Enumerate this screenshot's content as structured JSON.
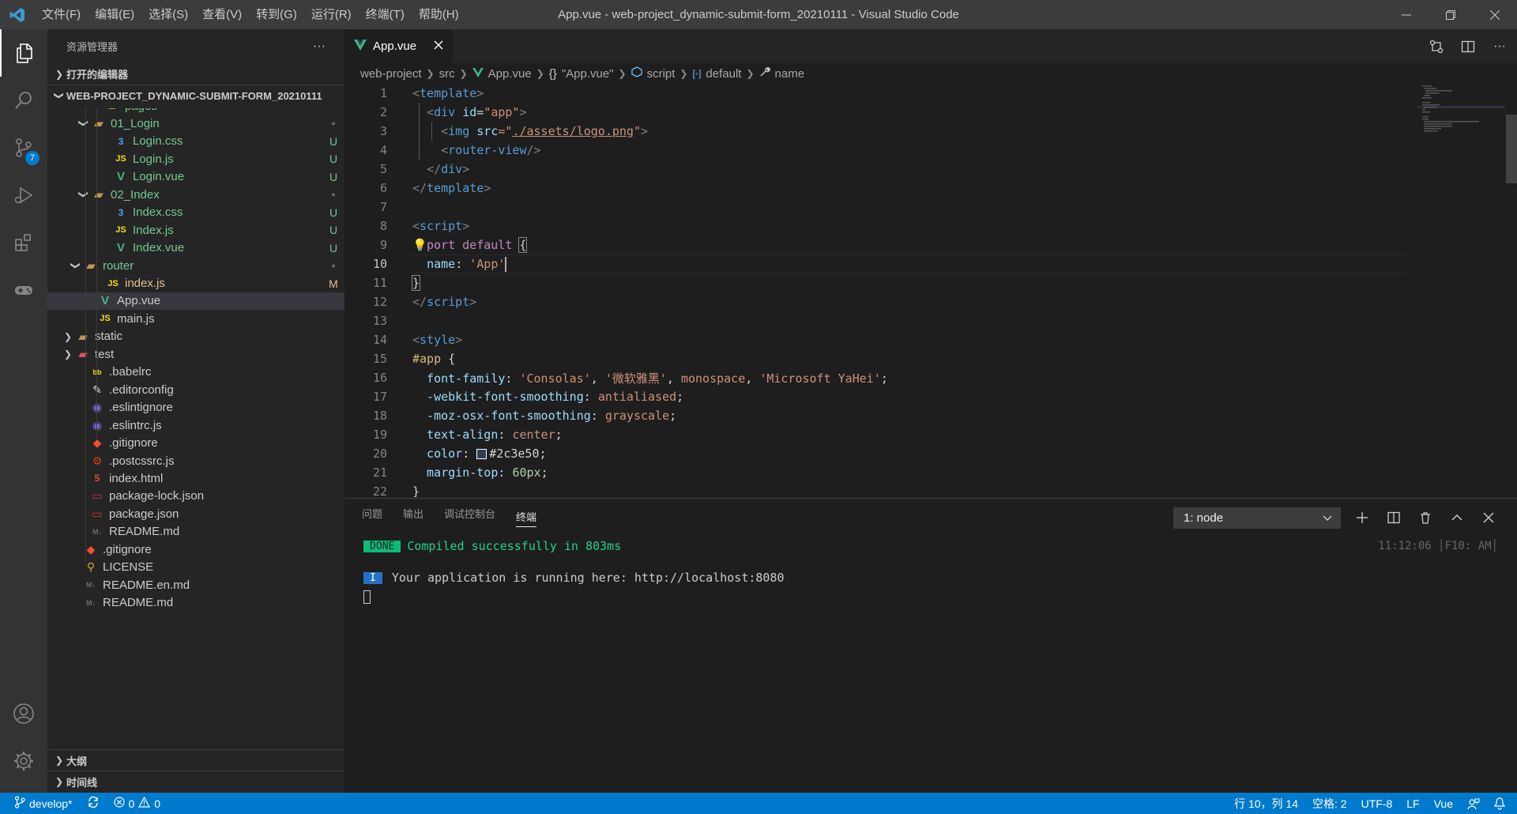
{
  "titlebar": {
    "menus": [
      "文件(F)",
      "编辑(E)",
      "选择(S)",
      "查看(V)",
      "转到(G)",
      "运行(R)",
      "终端(T)",
      "帮助(H)"
    ],
    "title": "App.vue - web-project_dynamic-submit-form_20210111 - Visual Studio Code"
  },
  "activitybar": {
    "scm_badge": "7"
  },
  "sidebar": {
    "title": "资源管理器",
    "more": "···",
    "open_editors": "打开的编辑器",
    "project": "WEB-PROJECT_DYNAMIC-SUBMIT-FORM_20210111",
    "outline": "大纲",
    "timeline": "时间线",
    "tree": [
      {
        "label": "pages",
        "icon": "folder-icon",
        "status": ""
      },
      {
        "label": "01_Login",
        "icon": "folder-icon",
        "status": "●"
      },
      {
        "label": "Login.css",
        "icon": "css-icon",
        "status": "U"
      },
      {
        "label": "Login.js",
        "icon": "js-icon",
        "status": "U"
      },
      {
        "label": "Login.vue",
        "icon": "vue-icon",
        "status": "U"
      },
      {
        "label": "02_Index",
        "icon": "folder-icon",
        "status": "●"
      },
      {
        "label": "Index.css",
        "icon": "css-icon",
        "status": "U"
      },
      {
        "label": "Index.js",
        "icon": "js-icon",
        "status": "U"
      },
      {
        "label": "Index.vue",
        "icon": "vue-icon",
        "status": "U"
      },
      {
        "label": "router",
        "icon": "folder-icon",
        "status": "●"
      },
      {
        "label": "index.js",
        "icon": "js-icon",
        "status": "M"
      },
      {
        "label": "App.vue",
        "icon": "vue-icon",
        "status": ""
      },
      {
        "label": "main.js",
        "icon": "js-icon",
        "status": ""
      },
      {
        "label": "static",
        "icon": "folder-icon",
        "status": ""
      },
      {
        "label": "test",
        "icon": "test-folder-icon",
        "status": ""
      },
      {
        "label": ".babelrc",
        "icon": "babel-icon",
        "status": ""
      },
      {
        "label": ".editorconfig",
        "icon": "editorconfig-icon",
        "status": ""
      },
      {
        "label": ".eslintignore",
        "icon": "eslint-icon",
        "status": ""
      },
      {
        "label": ".eslintrc.js",
        "icon": "eslint-icon",
        "status": ""
      },
      {
        "label": ".gitignore",
        "icon": "git-icon",
        "status": ""
      },
      {
        "label": ".postcssrc.js",
        "icon": "postcss-icon",
        "status": ""
      },
      {
        "label": "index.html",
        "icon": "html-icon",
        "status": ""
      },
      {
        "label": "package-lock.json",
        "icon": "npm-icon",
        "status": ""
      },
      {
        "label": "package.json",
        "icon": "npm-icon",
        "status": ""
      },
      {
        "label": "README.md",
        "icon": "markdown-icon",
        "status": ""
      },
      {
        "label": ".gitignore",
        "icon": "git-icon",
        "status": ""
      },
      {
        "label": "LICENSE",
        "icon": "license-icon",
        "status": ""
      },
      {
        "label": "README.en.md",
        "icon": "markdown-icon",
        "status": ""
      },
      {
        "label": "README.md",
        "icon": "markdown-icon",
        "status": ""
      }
    ]
  },
  "editor": {
    "tab_label": "App.vue",
    "breadcrumb": [
      "web-project",
      "src",
      "App.vue",
      "\"App.vue\"",
      "script",
      "default",
      "name"
    ],
    "line_numbers": [
      "1",
      "2",
      "3",
      "4",
      "5",
      "6",
      "7",
      "8",
      "9",
      "10",
      "11",
      "12",
      "13",
      "14",
      "15",
      "16",
      "17",
      "18",
      "19",
      "20",
      "21",
      "22"
    ],
    "code": {
      "l1_open": "<",
      "l1_tag": "template",
      "l1_close": ">",
      "l2_indent": "  ",
      "l2_open": "<",
      "l2_tag": "div",
      "l2_attr": " id",
      "l2_eq": "=",
      "l2_val": "\"app\"",
      "l2_close": ">",
      "l3_indent": "    ",
      "l3_open": "<",
      "l3_tag": "img",
      "l3_attr": " src",
      "l3_eq": "=\"",
      "l3_val": "./assets/logo.png",
      "l3_q": "\"",
      "l3_close": ">",
      "l4_indent": "    ",
      "l4_open": "<",
      "l4_tag": "router-view",
      "l4_close": "/>",
      "l5_indent": "  ",
      "l5_open": "</",
      "l5_tag": "div",
      "l5_close": ">",
      "l6_open": "</",
      "l6_tag": "template",
      "l6_close": ">",
      "l8_open": "<",
      "l8_tag": "script",
      "l8_close": ">",
      "l9_kw": "port default ",
      "l9_brace": "{",
      "l10_indent": "  ",
      "l10_prop": "name",
      "l10_colon": ": ",
      "l10_val": "'App'",
      "l11_brace": "}",
      "l12_open": "</",
      "l12_tag": "script",
      "l12_close": ">",
      "l14_open": "<",
      "l14_tag": "style",
      "l14_close": ">",
      "l15_sel": "#app",
      "l15_brace": " {",
      "l16_prop": "  font-family",
      "l16_colon": ": ",
      "l16_v1": "'Consolas'",
      "l16_c1": ", ",
      "l16_v2": "'微软雅黑'",
      "l16_c2": ", ",
      "l16_v3": "monospace",
      "l16_c3": ", ",
      "l16_v4": "'Microsoft YaHei'",
      "l16_end": ";",
      "l17_prop": "  -webkit-font-smoothing",
      "l17_colon": ": ",
      "l17_val": "antialiased",
      "l17_end": ";",
      "l18_prop": "  -moz-osx-font-smoothing",
      "l18_colon": ": ",
      "l18_val": "grayscale",
      "l18_end": ";",
      "l19_prop": "  text-align",
      "l19_colon": ": ",
      "l19_val": "center",
      "l19_end": ";",
      "l20_prop": "  color",
      "l20_colon": ": ",
      "l20_val": "#2c3e50",
      "l20_end": ";",
      "l21_prop": "  margin-top",
      "l21_colon": ": ",
      "l21_val": "60px",
      "l21_end": ";",
      "l22_brace": "}"
    },
    "color_swatch": "#2c3e50"
  },
  "panel": {
    "tabs": [
      "问题",
      "输出",
      "调试控制台",
      "终端"
    ],
    "active_tab": "终端",
    "terminal_select": "1: node",
    "done_badge": "DONE",
    "done_text": "Compiled successfully in 803ms",
    "info_badge": "I",
    "info_text": "Your application is running here: http://localhost:8080",
    "timestamp": "11:12:06 │F10: AM│"
  },
  "statusbar": {
    "branch": "develop*",
    "errors": "0",
    "warnings": "0",
    "position": "行 10，列 14",
    "spaces": "空格: 2",
    "encoding": "UTF-8",
    "eol": "LF",
    "language": "Vue"
  },
  "colors": {
    "accent": "#007acc",
    "vue_green": "#41b883",
    "js_yellow": "#f5de19",
    "css_blue": "#42a5f5",
    "untracked": "#73c991",
    "modified": "#e2c08d"
  }
}
